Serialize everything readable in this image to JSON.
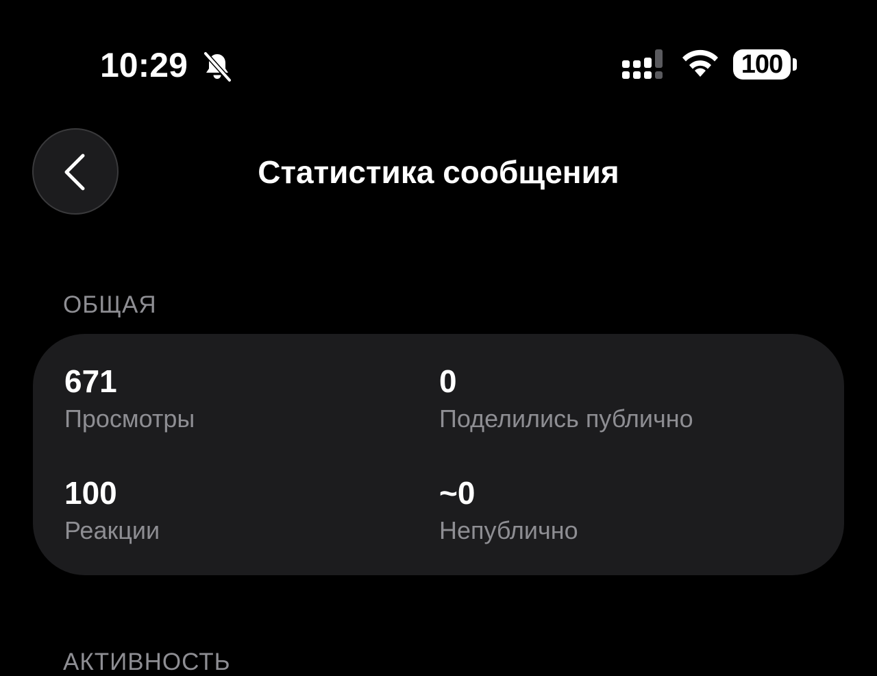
{
  "status_bar": {
    "time": "10:29",
    "bell_icon": "bell-slash-icon",
    "signal_icon": "cellular-signal-icon",
    "wifi_icon": "wifi-icon",
    "battery_level": "100"
  },
  "header": {
    "back_icon": "chevron-left-icon",
    "title": "Статистика сообщения"
  },
  "sections": {
    "general": {
      "label": "ОБЩАЯ",
      "stats": {
        "views": {
          "value": "671",
          "label": "Просмотры"
        },
        "shared_public": {
          "value": "0",
          "label": "Поделились публично"
        },
        "reactions": {
          "value": "100",
          "label": "Реакции"
        },
        "private": {
          "value": "~0",
          "label": "Непублично"
        }
      }
    },
    "activity": {
      "label": "АКТИВНОСТЬ"
    }
  },
  "colors": {
    "background": "#000000",
    "card": "#1c1c1e",
    "secondary_text": "#8e8e93",
    "primary_text": "#ffffff"
  }
}
